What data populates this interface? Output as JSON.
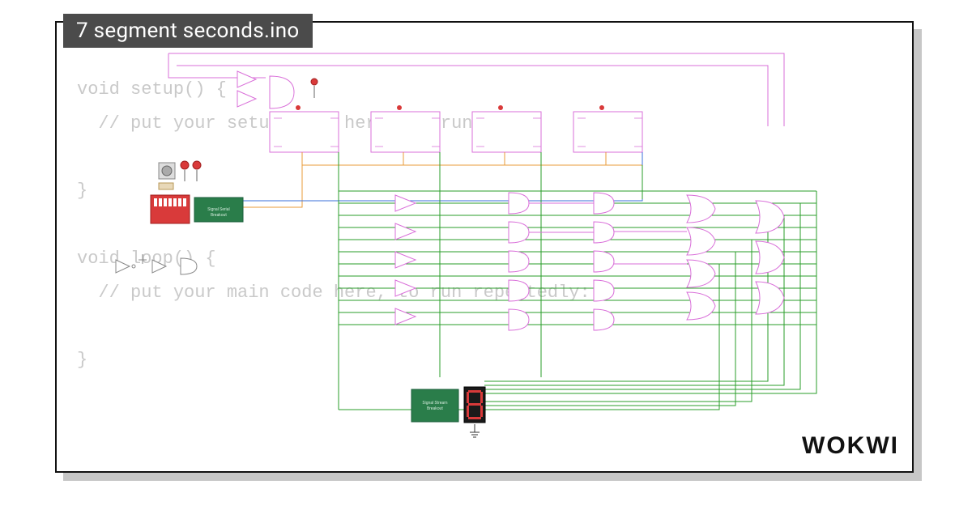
{
  "title": "7 segment seconds.ino",
  "brand": "WOKWI",
  "code": {
    "line1": "void setup() {",
    "line2": "  // put your setup code here, to run once:",
    "line3": "",
    "line4": "}",
    "line5": "",
    "line6": "void loop() {",
    "line7": "  // put your main code here, to run repeatedly:",
    "line8": "",
    "line9": "}"
  },
  "colors": {
    "title_bg": "#4b4b4b",
    "code_gray": "#c9c9c9",
    "wire_green": "#2a9d2a",
    "wire_magenta": "#d96fd9",
    "wire_orange": "#e89b3a",
    "wire_blue": "#3a6fd9",
    "wire_red": "#d93a3a",
    "chip_green": "#2a7d4a",
    "display_red": "#d93a3a"
  }
}
